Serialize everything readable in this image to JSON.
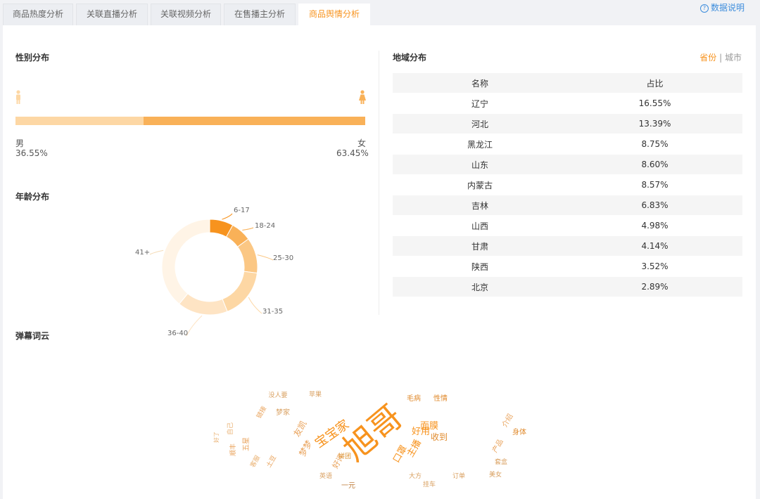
{
  "tabs": [
    {
      "label": "商品热度分析",
      "active": false
    },
    {
      "label": "关联直播分析",
      "active": false
    },
    {
      "label": "关联视频分析",
      "active": false
    },
    {
      "label": "在售播主分析",
      "active": false
    },
    {
      "label": "商品舆情分析",
      "active": true
    }
  ],
  "help_label": "数据说明",
  "gender": {
    "title": "性别分布",
    "male_label": "男",
    "male_pct": "36.55%",
    "male_fraction": 0.3655,
    "female_label": "女",
    "female_pct": "63.45%",
    "female_fraction": 0.6345
  },
  "age": {
    "title": "年龄分布",
    "chart_data": {
      "type": "pie",
      "categories": [
        "6-17",
        "18-24",
        "25-30",
        "31-35",
        "36-40",
        "41+"
      ],
      "values": [
        8,
        7,
        12,
        17,
        17,
        39
      ],
      "colors": [
        "#f7931e",
        "#f9b158",
        "#fbc784",
        "#fdd7a4",
        "#fee4c4",
        "#fff4e6"
      ]
    }
  },
  "region": {
    "title": "地域分布",
    "toggle_province": "省份",
    "toggle_sep": "|",
    "toggle_city": "城市",
    "headers": [
      "名称",
      "占比"
    ],
    "rows": [
      [
        "辽宁",
        "16.55%"
      ],
      [
        "河北",
        "13.39%"
      ],
      [
        "黑龙江",
        "8.75%"
      ],
      [
        "山东",
        "8.60%"
      ],
      [
        "内蒙古",
        "8.57%"
      ],
      [
        "吉林",
        "6.83%"
      ],
      [
        "山西",
        "4.98%"
      ],
      [
        "甘肃",
        "4.14%"
      ],
      [
        "陕西",
        "3.52%"
      ],
      [
        "北京",
        "2.89%"
      ]
    ]
  },
  "wordcloud": {
    "title": "弹幕词云",
    "words": [
      "旭哥",
      "宝宝家",
      "好用",
      "面膜",
      "毛病",
      "性情",
      "收到",
      "主播",
      "口罩",
      "友凯",
      "梦梦",
      "好评",
      "拼团",
      "一元",
      "套盒",
      "美女",
      "大方",
      "订单",
      "挂车",
      "英语",
      "身体",
      "产品",
      "介绍",
      "苹果",
      "梦家",
      "没人要",
      "五星",
      "顺丰",
      "链接",
      "土豆",
      "好了",
      "自己",
      "客服"
    ]
  }
}
